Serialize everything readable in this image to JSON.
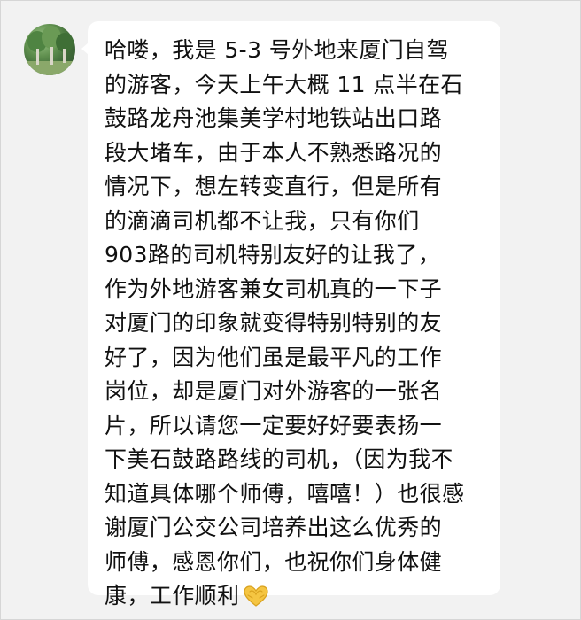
{
  "chat": {
    "avatar_icon": "user-avatar-trees-photo",
    "bubble_color": "#ffffff",
    "background_color": "#f2f2f2",
    "message_lines": [
      "哈喽，我是 5-3 号外地来厦门自驾",
      "的游客，今天上午大概 11 点半在石",
      "鼓路龙舟池集美学村地铁站出口路",
      "段大堵车，由于本人不熟悉路况的",
      "情况下，想左转变直行，但是所有",
      "的滴滴司机都不让我，只有你们",
      "903路的司机特别友好的让我了，",
      "作为外地游客兼女司机真的一下子",
      "对厦门的印象就变得特别特别的友",
      "好了，因为他们虽是最平凡的工作",
      "岗位，却是厦门对外游客的一张名",
      "片，所以请您一定要好好要表扬一",
      "下美石鼓路路线的司机，（因为我不",
      "知道具体哪个师傅，嘻嘻！）也很感",
      "谢厦门公交公司培养出这么优秀的",
      "师傅，感恩你们，也祝你们身体健",
      "康，工作顺利"
    ],
    "trailing_emoji": "heart-hands-emoji",
    "emoji_color": "#f5c542"
  }
}
